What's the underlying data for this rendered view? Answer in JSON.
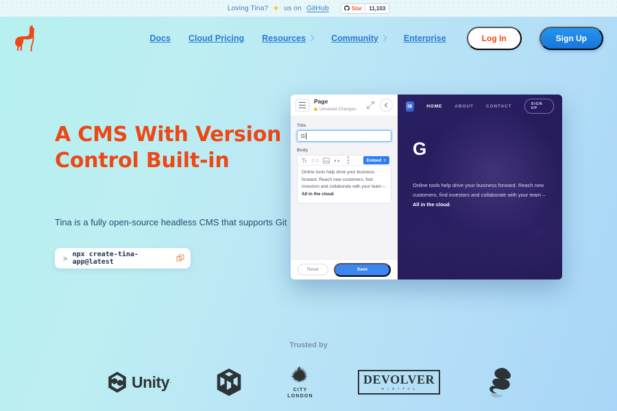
{
  "announcement": {
    "text": "Loving Tina?",
    "star_emoji": "★",
    "mid_text": "us on",
    "link_label": "GitHub",
    "github_button": {
      "label": "Star",
      "count": "11,103"
    }
  },
  "header": {
    "logo_name": "tina-llama-logo",
    "nav": [
      {
        "label": "Docs",
        "has_chevron": false
      },
      {
        "label": "Cloud Pricing",
        "has_chevron": false
      },
      {
        "label": "Resources",
        "has_chevron": true
      },
      {
        "label": "Community",
        "has_chevron": true
      },
      {
        "label": "Enterprise",
        "has_chevron": false
      }
    ],
    "login_label": "Log In",
    "signup_label": "Sign Up"
  },
  "hero": {
    "headline_line1": "A CMS With Version",
    "headline_line2": "Control Built-in",
    "subtitle": "Tina is a fully open-source headless CMS that supports Git",
    "command": {
      "prompt": ">",
      "text": "npx create-tina-app@latest",
      "copy_icon": "copy-icon"
    }
  },
  "product_shot": {
    "editor": {
      "title": "Page",
      "status": "Unsaved Changes",
      "menu_icon": "hamburger-icon",
      "expand_icon": "expand-icon",
      "back_icon": "chevron-left-icon",
      "title_field": {
        "label": "Title",
        "value": "G"
      },
      "body_field": {
        "label": "Body"
      },
      "toolbar": [
        {
          "name": "text-format-icon",
          "glyph": "T"
        },
        {
          "name": "link-icon",
          "glyph": "∞"
        },
        {
          "name": "image-icon",
          "glyph": "▣"
        },
        {
          "name": "quote-icon",
          "glyph": "❞"
        },
        {
          "name": "more-options-icon",
          "glyph": "⋮"
        }
      ],
      "embed_label": "Embed",
      "embed_plus": "+",
      "body_text_1": "Online tools help drive your business forward. Reach new customers, find investors and collaborate with your team – ",
      "body_text_bold": "All in the cloud",
      "body_text_2": ".",
      "reset_label": "Reset",
      "save_label": "Save"
    },
    "preview": {
      "logo_name": "preview-site-logo",
      "nav": [
        {
          "label": "HOME",
          "active": true
        },
        {
          "label": "ABOUT",
          "active": false
        },
        {
          "label": "CONTACT",
          "active": false
        }
      ],
      "signup_label": "SIGN UP",
      "heading": "G",
      "paragraph_1": "Online tools help drive your business forward. Reach new customers, find investors and collaborate with your team – ",
      "paragraph_bold": "All in the cloud",
      "paragraph_2": "."
    }
  },
  "trusted": {
    "label": "Trusted by",
    "logos": [
      {
        "name": "unity-logo",
        "text": "Unity"
      },
      {
        "name": "cube-logo",
        "text": ""
      },
      {
        "name": "city-of-london-logo",
        "line1": "CITY",
        "line2": "LONDON"
      },
      {
        "name": "devolver-digital-logo",
        "line1": "DEVOLVER",
        "line2": "D I G I T A L"
      },
      {
        "name": "s-mark-logo",
        "text": ""
      }
    ]
  },
  "colors": {
    "brand_orange": "#ec4815",
    "brand_blue": "#2296f0",
    "bg_gradient_start": "#b6f0ef",
    "bg_gradient_end": "#a9d6f8"
  }
}
